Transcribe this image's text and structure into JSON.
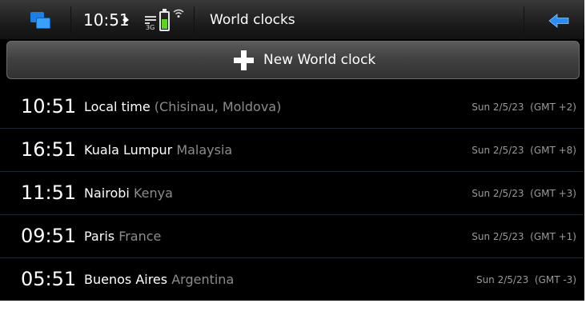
{
  "statusbar": {
    "clock": "10:51",
    "network_label": "3G",
    "title": "World clocks"
  },
  "new_button": {
    "label": "New World clock"
  },
  "clocks": [
    {
      "time": "10:51",
      "city": "Local time",
      "region": "(Chisinau, Moldova)",
      "date": "Sun 2/5/23",
      "offset": "(GMT +2)"
    },
    {
      "time": "16:51",
      "city": "Kuala Lumpur",
      "region": "Malaysia",
      "date": "Sun 2/5/23",
      "offset": "(GMT +8)"
    },
    {
      "time": "11:51",
      "city": "Nairobi",
      "region": "Kenya",
      "date": "Sun 2/5/23",
      "offset": "(GMT +3)"
    },
    {
      "time": "09:51",
      "city": "Paris",
      "region": "France",
      "date": "Sun 2/5/23",
      "offset": "(GMT +1)"
    },
    {
      "time": "05:51",
      "city": "Buenos Aires",
      "region": "Argentina",
      "date": "Sun 2/5/23",
      "offset": "(GMT -3)"
    }
  ],
  "colors": {
    "accent_blue": "#1f7fe0",
    "battery_green": "#5fd12a",
    "secondary_text": "#8c8c8c"
  },
  "icons": {
    "task_switcher": "task-switcher-icon",
    "presence": "presence-icon",
    "network": "network-3g-icon",
    "battery": "battery-icon",
    "wifi": "wifi-icon",
    "back": "back-arrow-icon",
    "add": "plus-icon"
  }
}
